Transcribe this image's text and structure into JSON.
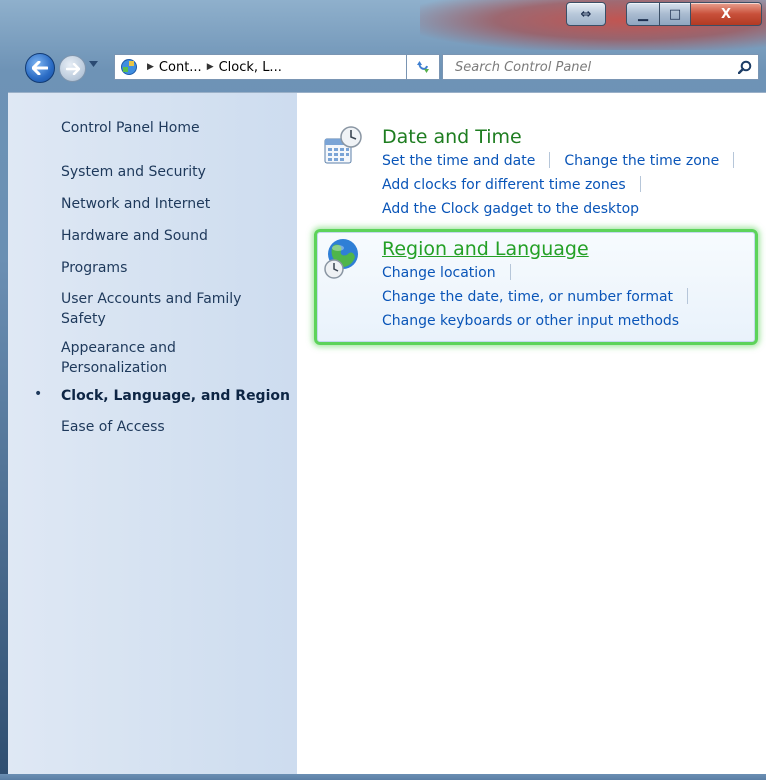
{
  "window": {
    "snap_glyph": "⇔",
    "min_glyph": "▁",
    "max_glyph": "□",
    "close_glyph": "X"
  },
  "address": {
    "breadcrumbs": [
      "Cont...",
      "Clock, L..."
    ],
    "search_placeholder": "Search Control Panel"
  },
  "sidebar": {
    "home": "Control Panel Home",
    "items": [
      {
        "label": "System and Security"
      },
      {
        "label": "Network and Internet"
      },
      {
        "label": "Hardware and Sound"
      },
      {
        "label": "Programs"
      },
      {
        "label": "User Accounts and Family Safety"
      },
      {
        "label": "Appearance and Personalization"
      },
      {
        "label": "Clock, Language, and Region",
        "active": true
      },
      {
        "label": "Ease of Access"
      }
    ],
    "bullet": "•"
  },
  "categories": [
    {
      "title": "Date and Time",
      "icon": "calendar-clock-icon",
      "tasks": [
        "Set the time and date",
        "Change the time zone",
        "Add clocks for different time zones",
        "Add the Clock gadget to the desktop"
      ]
    },
    {
      "title": "Region and Language",
      "icon": "globe-clock-icon",
      "highlighted": true,
      "tasks": [
        "Change location",
        "Change the date, time, or number format",
        "Change keyboards or other input methods"
      ]
    }
  ],
  "colors": {
    "category_title": "#1e7d20",
    "task_link": "#0a55b8",
    "highlight_border": "#5dd35a",
    "sidebar_bg": "#d4e1f1"
  }
}
